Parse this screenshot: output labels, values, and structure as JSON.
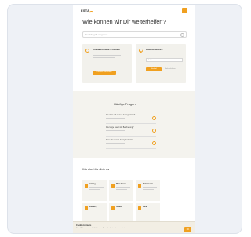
{
  "header": {
    "logo_text": "ESTA"
  },
  "hero": {
    "heading": "Wie können wir Dir weiterhelfen?",
    "search_placeholder": "Suchbegriff eingeben"
  },
  "cards": [
    {
      "title": "Kontaktformular & Hotline",
      "button": "Kontakt aufnehmen"
    },
    {
      "title": "Rückruf-Service",
      "field_placeholder": "Telefonnummer",
      "button": "Rückruf",
      "link": "Mehr erfahren"
    }
  ],
  "help": {
    "title": "Häufige Fragen",
    "questions": [
      "Wie finde ich meinen Antragsstatus?",
      "Wie lange dauert die Bearbeitung?",
      "Kann ich meinen Antrag ändern?"
    ]
  },
  "services": {
    "title": "Wir sind für dich da",
    "tiles": [
      "Antrag",
      "Mein Konto",
      "Dokumente",
      "Zahlung",
      "Status",
      "Hilfe"
    ]
  },
  "cookie": {
    "title": "Cookie-Hinweis",
    "text": "Diese Webseite verwendet Cookies, um Ihnen den besten Service zu bieten.",
    "button": "OK"
  },
  "colors": {
    "accent": "#f0a020",
    "panel": "#f2f1ec",
    "background": "#eef1f6"
  }
}
